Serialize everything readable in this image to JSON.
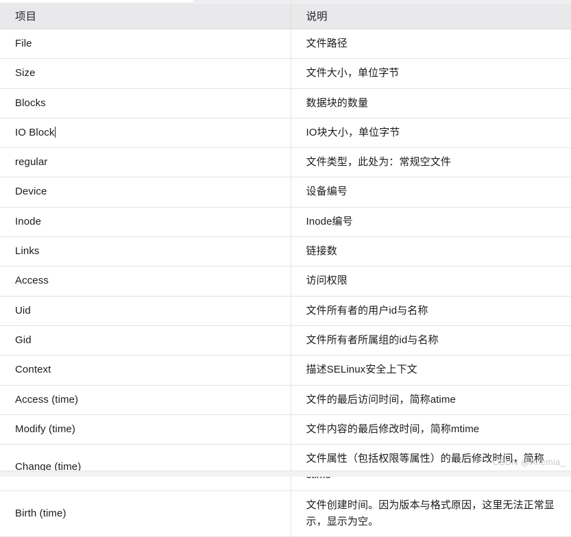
{
  "table": {
    "headers": [
      "项目",
      "说明"
    ],
    "rows": [
      {
        "item": "File",
        "desc": "文件路径"
      },
      {
        "item": "Size",
        "desc": "文件大小，单位字节"
      },
      {
        "item": "Blocks",
        "desc": "数据块的数量"
      },
      {
        "item": "IO Block",
        "desc": "IO块大小，单位字节",
        "caret": true
      },
      {
        "item": "regular",
        "desc": "文件类型，此处为：常规空文件"
      },
      {
        "item": "Device",
        "desc": "设备编号"
      },
      {
        "item": "Inode",
        "desc": "Inode编号"
      },
      {
        "item": "Links",
        "desc": "链接数"
      },
      {
        "item": "Access",
        "desc": "访问权限"
      },
      {
        "item": "Uid",
        "desc": "文件所有者的用户id与名称"
      },
      {
        "item": "Gid",
        "desc": "文件所有者所属组的id与名称"
      },
      {
        "item": "Context",
        "desc": "描述SELinux安全上下文"
      },
      {
        "item": "Access (time)",
        "desc": "文件的最后访问时间，简称atime"
      },
      {
        "item": "Modify (time)",
        "desc": "文件内容的最后修改时间，简称mtime"
      },
      {
        "item": "Change (time)",
        "desc": "文件属性（包括权限等属性）的最后修改时间，简称ctime"
      },
      {
        "item": "Birth (time)",
        "desc": "文件创建时间。因为版本与格式原因，这里无法正常显示，显示为空。"
      }
    ]
  },
  "watermark": {
    "text": "CSDN @Anemia_"
  },
  "colors": {
    "header_background": "#e9e9eb",
    "row_border": "#e3e3e6",
    "text": "#1b1b1f",
    "watermark": "#c9c9cc"
  }
}
